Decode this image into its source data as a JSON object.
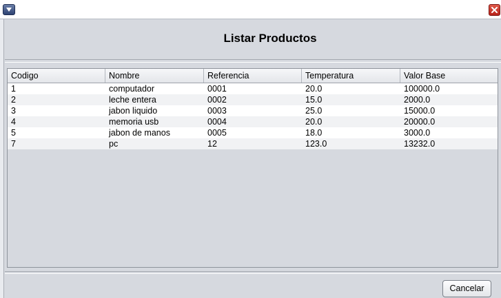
{
  "window": {
    "title": "Listar Productos",
    "menu_icon": "chevron-down-icon",
    "close_icon": "close-icon"
  },
  "table": {
    "columns": [
      "Codigo",
      "Nombre",
      "Referencia",
      "Temperatura",
      "Valor Base"
    ],
    "rows": [
      [
        "1",
        "computador",
        "0001",
        "20.0",
        "100000.0"
      ],
      [
        "2",
        "leche entera",
        "0002",
        "15.0",
        "2000.0"
      ],
      [
        "3",
        "jabon liquido",
        "0003",
        "25.0",
        "15000.0"
      ],
      [
        "4",
        "memoria usb",
        "0004",
        "20.0",
        "20000.0"
      ],
      [
        "5",
        "jabon de manos",
        "0005",
        "18.0",
        "3000.0"
      ],
      [
        "7",
        "pc",
        "12",
        "123.0",
        "13232.0"
      ]
    ]
  },
  "footer": {
    "cancel_label": "Cancelar"
  },
  "colors": {
    "background": "#d6d9df",
    "close_button": "#c9362a",
    "menu_button": "#3f5583"
  }
}
